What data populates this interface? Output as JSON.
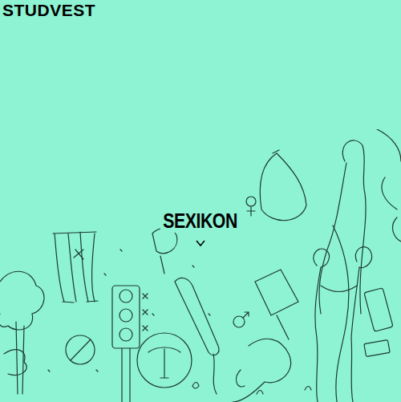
{
  "header": {
    "logo": "STUDVEST"
  },
  "hero": {
    "title": "SEXIKON"
  }
}
